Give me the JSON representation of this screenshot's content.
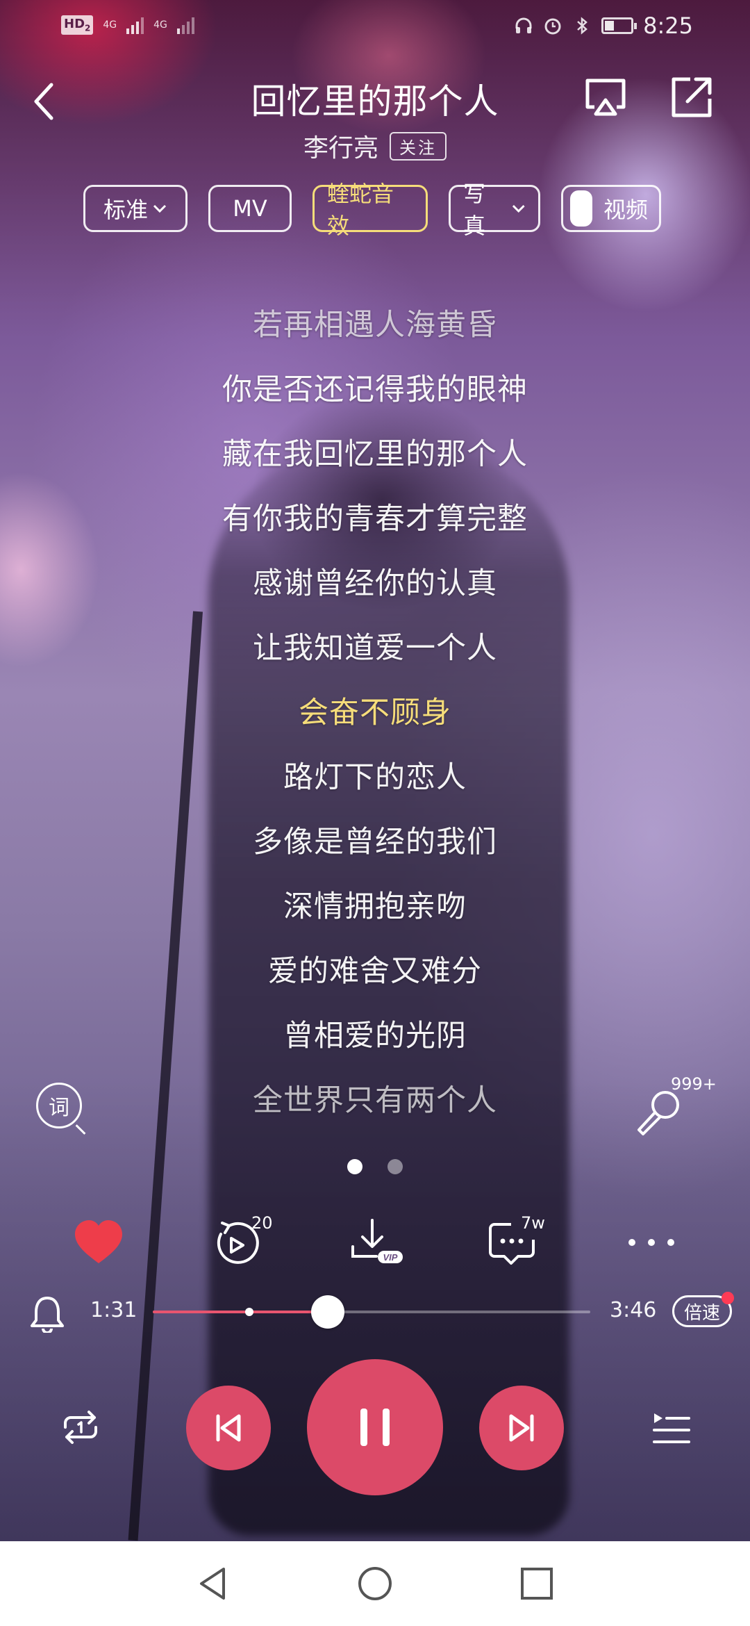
{
  "status_bar": {
    "hd_label": "HD",
    "hd_sub": "2",
    "network_1": "4G",
    "network_2": "4G",
    "time": "8:25",
    "battery_level": 0.35,
    "icons": [
      "headset-icon",
      "alarm-icon",
      "bluetooth-icon",
      "battery-icon"
    ]
  },
  "header": {
    "title": "回忆里的那个人",
    "artist": "李行亮",
    "follow_label": "关注",
    "icons": [
      "chevron-left-icon",
      "cast-icon",
      "share-icon"
    ]
  },
  "pills": [
    {
      "label": "标准",
      "dropdown": true,
      "style": "normal"
    },
    {
      "label": "MV",
      "dropdown": false,
      "style": "normal"
    },
    {
      "label": "蝰蛇音效",
      "dropdown": false,
      "style": "gold"
    },
    {
      "label": "写真",
      "dropdown": true,
      "style": "normal"
    },
    {
      "label": "视频",
      "dropdown": false,
      "style": "toggle"
    }
  ],
  "lyrics": {
    "lines": [
      "若再相遇人海黄昏",
      "你是否还记得我的眼神",
      "藏在我回忆里的那个人",
      "有你我的青春才算完整",
      "感谢曾经你的认真",
      "让我知道爱一个人",
      "会奋不顾身",
      "路灯下的恋人",
      "多像是曾经的我们",
      "深情拥抱亲吻",
      "爱的难舍又难分",
      "曾相爱的光阴",
      "全世界只有两个人"
    ],
    "current_index": 6
  },
  "side_controls": {
    "lyrics_button_label": "词",
    "karaoke_count": "999+"
  },
  "pager": {
    "count": 2,
    "active": 0
  },
  "actions": {
    "replay_count": "20",
    "download_badge": "VIP",
    "comment_count": "7w"
  },
  "progress": {
    "current_time": "1:31",
    "total_time": "3:46",
    "played_fraction": 0.4,
    "buffered_fraction": 0.22,
    "speed_label": "倍速"
  },
  "colors": {
    "accent": "#dc4a68",
    "current_lyric": "#f6dd7a",
    "progress_played": "#e8556f",
    "notification_dot": "#ff3b55"
  }
}
